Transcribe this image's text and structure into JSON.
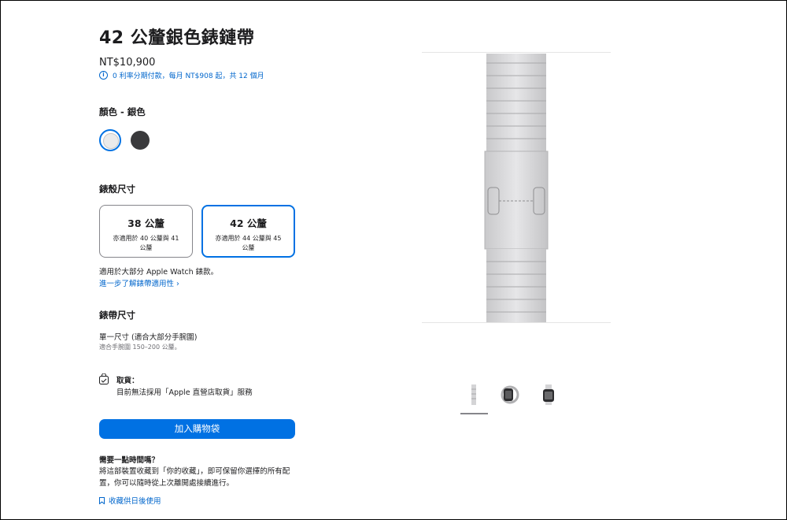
{
  "product": {
    "title": "42 公釐銀色錶鏈帶",
    "price": "NT$10,900",
    "installment": "0 利率分期付款，每月 NT$908 起，共 12 個月"
  },
  "color": {
    "heading": "顏色 - 銀色",
    "options": [
      {
        "name": "silver",
        "hex": "#ebebeb",
        "selected": true
      },
      {
        "name": "space-black",
        "hex": "#3a3a3c",
        "selected": false
      }
    ]
  },
  "case_size": {
    "heading": "錶殼尺寸",
    "options": [
      {
        "label": "38 公釐",
        "sub": "亦適用於 40 公釐與 41 公釐",
        "selected": false
      },
      {
        "label": "42 公釐",
        "sub": "亦適用於 44 公釐與 45 公釐",
        "selected": true
      }
    ],
    "compat_note": "適用於大部分 Apple Watch 錶款。",
    "learn_more": "進一步了解錶帶適用性 ›"
  },
  "band_size": {
    "heading": "錶帶尺寸",
    "value": "單一尺寸 (適合大部分手腕圍)",
    "note": "適合手腕圍 150–200 公釐。"
  },
  "pickup": {
    "title": "取貨：",
    "text": "目前無法採用「Apple 直營店取貨」服務"
  },
  "add_to_bag": "加入購物袋",
  "save": {
    "title": "需要一點時間嗎？",
    "text": "將這部裝置收藏到「你的收藏」，即可保留你選擇的所有配置，你可以隨時從上次離開處接續進行。",
    "link": "收藏供日後使用"
  },
  "colors": {
    "accent": "#0071e3",
    "link": "#0066cc",
    "text": "#1d1d1f"
  },
  "icons": [
    "info-icon",
    "bag-icon",
    "bookmark-icon"
  ]
}
